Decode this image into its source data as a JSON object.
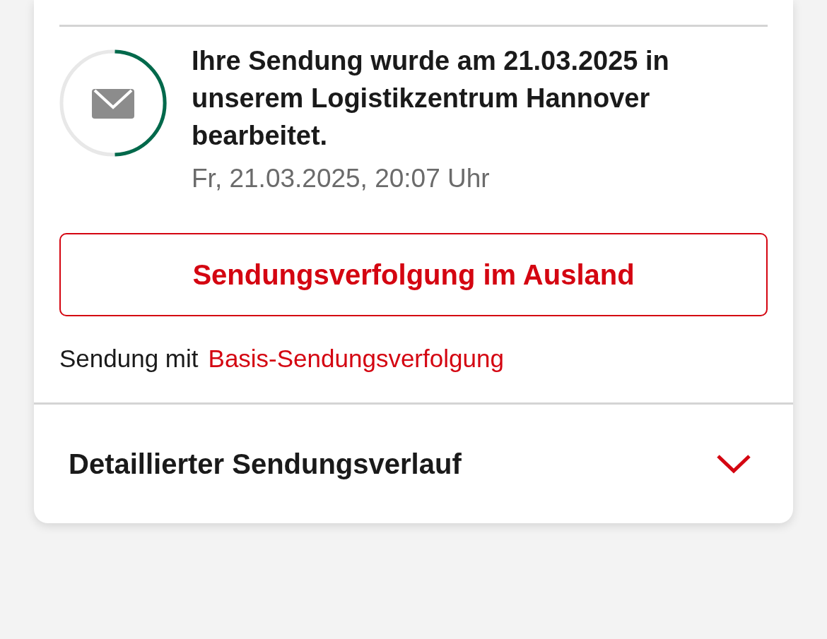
{
  "event": {
    "status_ring": {
      "level": 0.5
    },
    "message": "Ihre Sendung wurde am 21.03.2025 in unserem Logistikzentrum Hannover bearbeitet.",
    "timestamp": "Fr, 21.03.2025, 20:07 Uhr"
  },
  "foreign_tracking_button": {
    "label": "Sendungsverfolgung im Ausland"
  },
  "tracking_type": {
    "text": "Sendung mit",
    "link": "Basis-Sendungsverfolgung"
  },
  "history_section": {
    "title": "Detaillierter Sendungsverlauf",
    "expanded": false
  }
}
